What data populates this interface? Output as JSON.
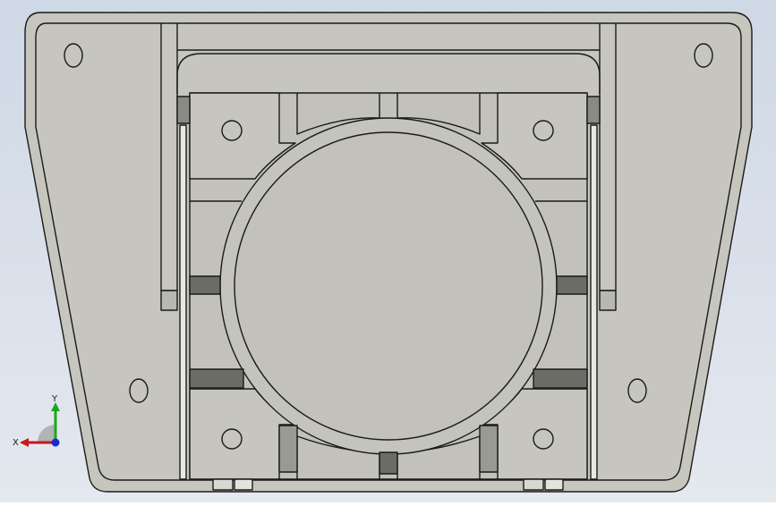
{
  "viewport": {
    "background_top": "#cfd8e6",
    "background_bottom": "#e4e8ef",
    "part_fill": "#c6c6be",
    "part_fill_light": "#c2c2ba",
    "edge_color": "#1a1a1a",
    "slot_fill": "#6c6c66",
    "rod_fill": "#e8e8e2"
  },
  "triad": {
    "x_label": "X",
    "y_label": "Y",
    "x_color": "#c81818",
    "y_color": "#1aa81a",
    "z_color": "#1a2ad0"
  }
}
